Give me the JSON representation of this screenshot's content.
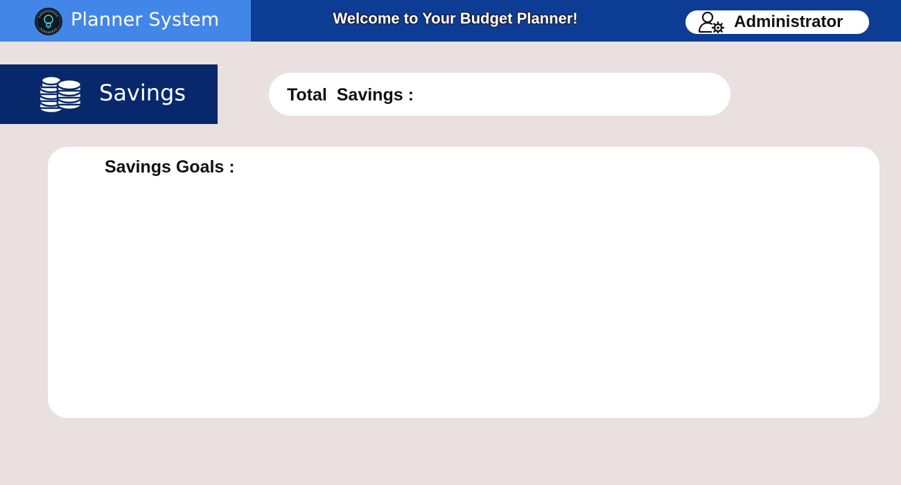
{
  "header": {
    "brand_name": "Planner System",
    "welcome": "Welcome to Your Budget Planner!",
    "user_role": "Administrator"
  },
  "section": {
    "title": "Savings"
  },
  "total_savings": {
    "label": "Total  Savings :",
    "value": ""
  },
  "savings_goals": {
    "label": "Savings Goals :"
  },
  "icons": {
    "logo": "budget-planner-logo",
    "admin": "user-gear-icon",
    "section": "coins-stack-icon"
  },
  "colors": {
    "page_background": "#eae0df",
    "header_background": "#0d3c94",
    "brand_background": "#4286e8",
    "section_tab_background": "#07296b",
    "card_background": "#ffffff"
  }
}
